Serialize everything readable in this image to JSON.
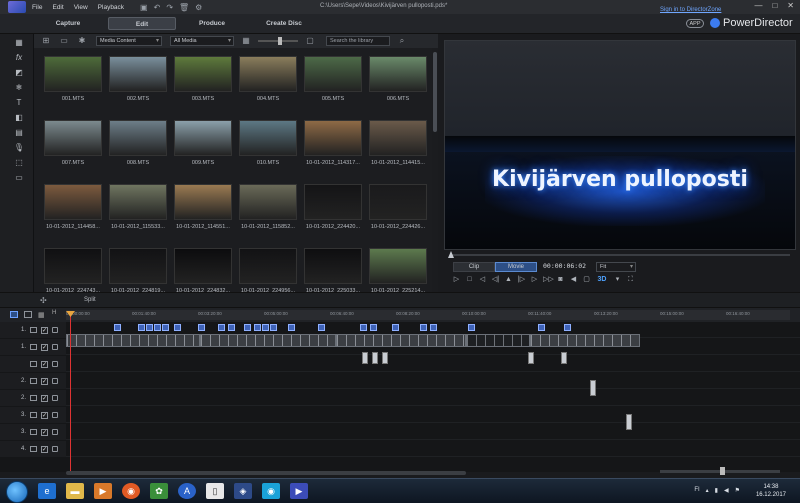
{
  "window": {
    "menu": [
      "File",
      "Edit",
      "View",
      "Playback"
    ],
    "file_path": "C:\\Users\\Sepe\\Videos\\Kivijärven pulloposti.pds*",
    "controls": [
      "—",
      "□",
      "✕"
    ]
  },
  "modes": {
    "tabs": [
      "Capture",
      "Edit",
      "Produce",
      "Create Disc"
    ],
    "active": "Edit"
  },
  "header_right": {
    "signin": "Sign in to DirectorZone",
    "app_badge": "APP",
    "brand": "PowerDirector"
  },
  "library": {
    "filter1": "Media Content",
    "filter2": "All Media",
    "search_placeholder": "Search the library",
    "items": [
      {
        "label": "001.MTS",
        "color": "#4e6b3a"
      },
      {
        "label": "002.MTS",
        "color": "#7a8f9c"
      },
      {
        "label": "003.MTS",
        "color": "#5e7a3c"
      },
      {
        "label": "004.MTS",
        "color": "#8a7d5c"
      },
      {
        "label": "005.MTS",
        "color": "#4d6a48"
      },
      {
        "label": "006.MTS",
        "color": "#6a8a6a"
      },
      {
        "label": "007.MTS",
        "color": "#7c8a8e"
      },
      {
        "label": "008.MTS",
        "color": "#6d7e88"
      },
      {
        "label": "009.MTS",
        "color": "#8ba0aa"
      },
      {
        "label": "010.MTS",
        "color": "#5d7884"
      },
      {
        "label": "10-01-2012_114317...",
        "color": "#8e6a46"
      },
      {
        "label": "10-01-2012_114415...",
        "color": "#6a5a4a"
      },
      {
        "label": "10-01-2012_114458...",
        "color": "#7c5a3e"
      },
      {
        "label": "10-01-2012_115533...",
        "color": "#6f7560"
      },
      {
        "label": "10-01-2012_114551...",
        "color": "#9a7a52"
      },
      {
        "label": "10-01-2012_115852...",
        "color": "#6a6a58"
      },
      {
        "label": "10-01-2012_224420...",
        "color": "#141416"
      },
      {
        "label": "10-01-2012_224426...",
        "color": "#1a1a1c"
      },
      {
        "label": "10-01-2012_224743...",
        "color": "#101012"
      },
      {
        "label": "10-01-2012_224819...",
        "color": "#121214"
      },
      {
        "label": "10-01-2012_224832...",
        "color": "#0c0c0e"
      },
      {
        "label": "10-01-2012_224956...",
        "color": "#121214"
      },
      {
        "label": "10-01-2012_225033...",
        "color": "#0e0e10"
      },
      {
        "label": "10-01-2012_225214...",
        "color": "#5d7a4e"
      }
    ]
  },
  "preview": {
    "title_text": "Kivijärven pulloposti",
    "clip_btn": "Clip",
    "movie_btn": "Movie",
    "timecode": "00:00:06:02",
    "fit": "Fit",
    "threed": "3D"
  },
  "toolbar": {
    "split": "Split"
  },
  "timeline": {
    "ticks": [
      "00:00:00:00",
      "00:01:40:00",
      "00:03:20:00",
      "00:05:00:00",
      "00:06:40:00",
      "00:08:20:00",
      "00:10:00:00",
      "00:11:40:00",
      "00:13:20:00",
      "00:15:00:00",
      "00:16:40:00"
    ],
    "tracks": [
      "1.",
      "1.",
      "",
      "2.",
      "2.",
      "3.",
      "3.",
      "4."
    ]
  },
  "taskbar": {
    "tray_lang": "FI",
    "time": "14:38",
    "date": "16.12.2017"
  }
}
